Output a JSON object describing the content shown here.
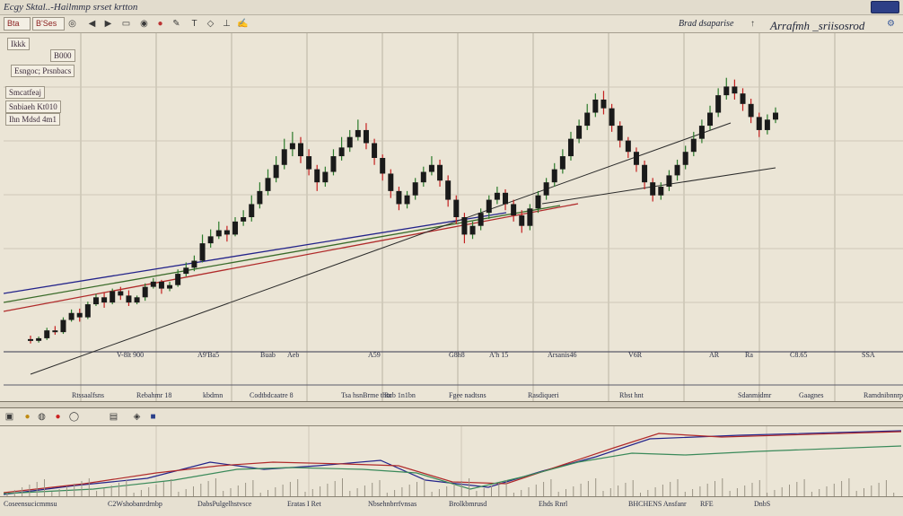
{
  "window": {
    "title": "Ecgy  Sktal..-Hailmmp srset  krtton"
  },
  "toolbar": {
    "field1": "Bta",
    "field2": "B'Ses",
    "symbol_left": "Brad  dsaparise",
    "symbol_right": "Arrafmh  _sriisosrod",
    "icons": [
      "back-icon",
      "forward-icon",
      "record-icon",
      "draw-icon",
      "text-icon",
      "shape-icon",
      "ruler-icon",
      "pen-icon",
      "cursor-icon"
    ]
  },
  "info_panel": {
    "row1": "Ikkk",
    "row1_value": "B000",
    "row2": "Esngoc; Prsnbacs",
    "row3": "Smcatfeaj",
    "row4": "Snbiaeh  Kt010",
    "row5": "Ihn Mdsd  4m1"
  },
  "date_labels_upper": [
    "V-8lt 900",
    "A9'Ba5",
    "Buab",
    "Aeb",
    "A59",
    "G8h8",
    "A'h 15",
    "Arsanis46",
    "V6R",
    "AR",
    "Ra",
    "C8.65",
    "SSA"
  ],
  "date_labels_mid": [
    "Rtssaalfsns",
    "Rebahmr 18",
    "kbdmn",
    "Codtbdcaatre 8",
    "Tsa hsnBrme thm",
    "Rcb 1n1bn",
    "Fgee nadtsns",
    "Rasdiqueri",
    "Rbst hnt",
    "Sdanmidmr",
    "Gaagnes",
    "Ramdnibnnrp"
  ],
  "date_labels_bottom": [
    "Coseensucicmmsu",
    "C2Wshobanrdrnbp",
    "DabsPulgelhstvsce",
    "Eratas  I  Ret",
    "Nbsehnbrrfvnsas",
    "Brolkbmrusd",
    "Ehds  Rnrl",
    "BHCHENS Ansfanr",
    "RFE",
    "DnbS"
  ],
  "lower_toolbar": {
    "icons": [
      "monitor-icon",
      "coin-icon",
      "alert-icon",
      "settings-icon",
      "crosshair-icon",
      "print-icon",
      "color-icon"
    ]
  },
  "colors": {
    "background": "#ebe5d6",
    "candle": "#1a1a1a",
    "wick_up": "#2b7a2b",
    "wick_down": "#c42020",
    "trend_blue": "#23238a",
    "trend_red": "#b02a2a",
    "trend_green": "#3a6b2a"
  },
  "chart_data": {
    "type": "candlestick",
    "title": "",
    "candles": [
      [
        30,
        28,
        34,
        25
      ],
      [
        28,
        31,
        33,
        26
      ],
      [
        31,
        40,
        43,
        29
      ],
      [
        40,
        38,
        45,
        35
      ],
      [
        38,
        52,
        55,
        36
      ],
      [
        52,
        60,
        64,
        50
      ],
      [
        60,
        55,
        65,
        50
      ],
      [
        55,
        70,
        73,
        53
      ],
      [
        70,
        78,
        82,
        68
      ],
      [
        78,
        72,
        84,
        66
      ],
      [
        72,
        85,
        88,
        70
      ],
      [
        85,
        80,
        90,
        75
      ],
      [
        80,
        72,
        86,
        68
      ],
      [
        72,
        78,
        80,
        70
      ],
      [
        78,
        90,
        94,
        74
      ],
      [
        90,
        96,
        100,
        88
      ],
      [
        96,
        88,
        98,
        82
      ],
      [
        88,
        92,
        96,
        85
      ],
      [
        92,
        105,
        110,
        90
      ],
      [
        105,
        112,
        118,
        102
      ],
      [
        112,
        120,
        126,
        108
      ],
      [
        120,
        140,
        150,
        118
      ],
      [
        140,
        148,
        156,
        135
      ],
      [
        148,
        155,
        165,
        145
      ],
      [
        155,
        150,
        160,
        142
      ],
      [
        150,
        165,
        170,
        148
      ],
      [
        165,
        170,
        178,
        160
      ],
      [
        170,
        185,
        195,
        165
      ],
      [
        185,
        200,
        210,
        180
      ],
      [
        200,
        215,
        225,
        195
      ],
      [
        215,
        230,
        240,
        210
      ],
      [
        230,
        248,
        260,
        225
      ],
      [
        248,
        255,
        268,
        240
      ],
      [
        255,
        240,
        262,
        232
      ],
      [
        240,
        225,
        248,
        218
      ],
      [
        225,
        210,
        230,
        200
      ],
      [
        210,
        222,
        228,
        205
      ],
      [
        222,
        240,
        248,
        218
      ],
      [
        240,
        250,
        262,
        235
      ],
      [
        250,
        262,
        270,
        245
      ],
      [
        262,
        270,
        282,
        258
      ],
      [
        270,
        255,
        278,
        248
      ],
      [
        255,
        238,
        260,
        230
      ],
      [
        238,
        220,
        242,
        212
      ],
      [
        220,
        200,
        225,
        192
      ],
      [
        200,
        185,
        205,
        178
      ],
      [
        185,
        195,
        200,
        180
      ],
      [
        195,
        210,
        215,
        190
      ],
      [
        210,
        222,
        228,
        205
      ],
      [
        222,
        230,
        240,
        218
      ],
      [
        230,
        212,
        236,
        205
      ],
      [
        212,
        190,
        218,
        182
      ],
      [
        190,
        170,
        195,
        162
      ],
      [
        170,
        150,
        175,
        140
      ],
      [
        150,
        160,
        165,
        145
      ],
      [
        160,
        175,
        180,
        155
      ],
      [
        175,
        190,
        195,
        168
      ],
      [
        190,
        198,
        205,
        185
      ],
      [
        198,
        185,
        202,
        178
      ],
      [
        185,
        172,
        190,
        165
      ],
      [
        172,
        160,
        178,
        152
      ],
      [
        160,
        180,
        185,
        155
      ],
      [
        180,
        195,
        200,
        175
      ],
      [
        195,
        210,
        215,
        190
      ],
      [
        210,
        225,
        232,
        205
      ],
      [
        225,
        240,
        248,
        220
      ],
      [
        240,
        260,
        268,
        235
      ],
      [
        260,
        275,
        282,
        255
      ],
      [
        275,
        290,
        300,
        270
      ],
      [
        290,
        305,
        312,
        285
      ],
      [
        305,
        295,
        315,
        288
      ],
      [
        295,
        275,
        300,
        268
      ],
      [
        275,
        258,
        280,
        250
      ],
      [
        258,
        245,
        262,
        238
      ],
      [
        245,
        230,
        250,
        222
      ],
      [
        230,
        210,
        235,
        202
      ],
      [
        210,
        195,
        215,
        188
      ],
      [
        195,
        205,
        210,
        190
      ],
      [
        205,
        218,
        224,
        200
      ],
      [
        218,
        230,
        236,
        212
      ],
      [
        230,
        245,
        252,
        225
      ],
      [
        245,
        260,
        268,
        240
      ],
      [
        260,
        275,
        282,
        255
      ],
      [
        275,
        290,
        298,
        270
      ],
      [
        290,
        310,
        318,
        285
      ],
      [
        310,
        320,
        330,
        305
      ],
      [
        320,
        312,
        328,
        305
      ],
      [
        312,
        300,
        318,
        292
      ],
      [
        300,
        285,
        306,
        278
      ],
      [
        285,
        270,
        290,
        262
      ],
      [
        270,
        282,
        288,
        265
      ],
      [
        282,
        290,
        296,
        278
      ]
    ]
  }
}
